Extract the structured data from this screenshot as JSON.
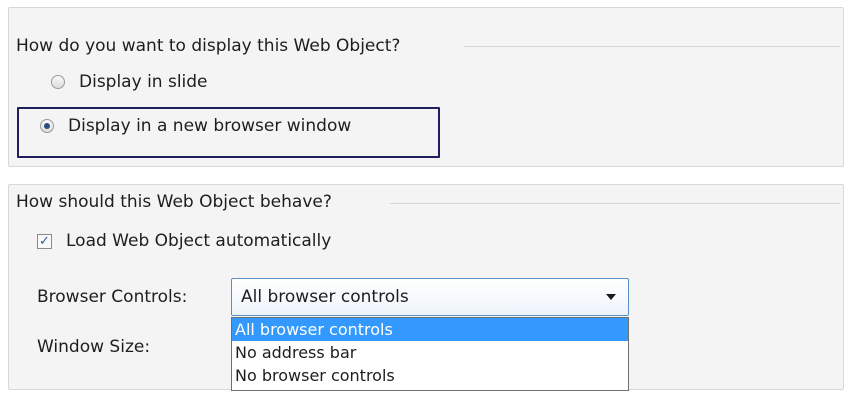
{
  "display_group": {
    "title": "How do you want to display this Web Object?",
    "options": [
      {
        "label": "Display in slide",
        "checked": false
      },
      {
        "label": "Display in a new browser window",
        "checked": true
      }
    ]
  },
  "behave_group": {
    "title": "How should this Web Object behave?",
    "load_automatically": {
      "label": "Load Web Object automatically",
      "checked": true,
      "mark": "✓"
    },
    "browser_controls": {
      "label": "Browser Controls:",
      "selected": "All browser controls",
      "options": [
        "All browser controls",
        "No address bar",
        "No browser controls"
      ]
    },
    "window_size": {
      "label": "Window Size:"
    }
  },
  "colors": {
    "highlight_border": "#1f1f5e",
    "selected_option_bg": "#3399ff",
    "panel_bg": "#f4f4f4"
  }
}
